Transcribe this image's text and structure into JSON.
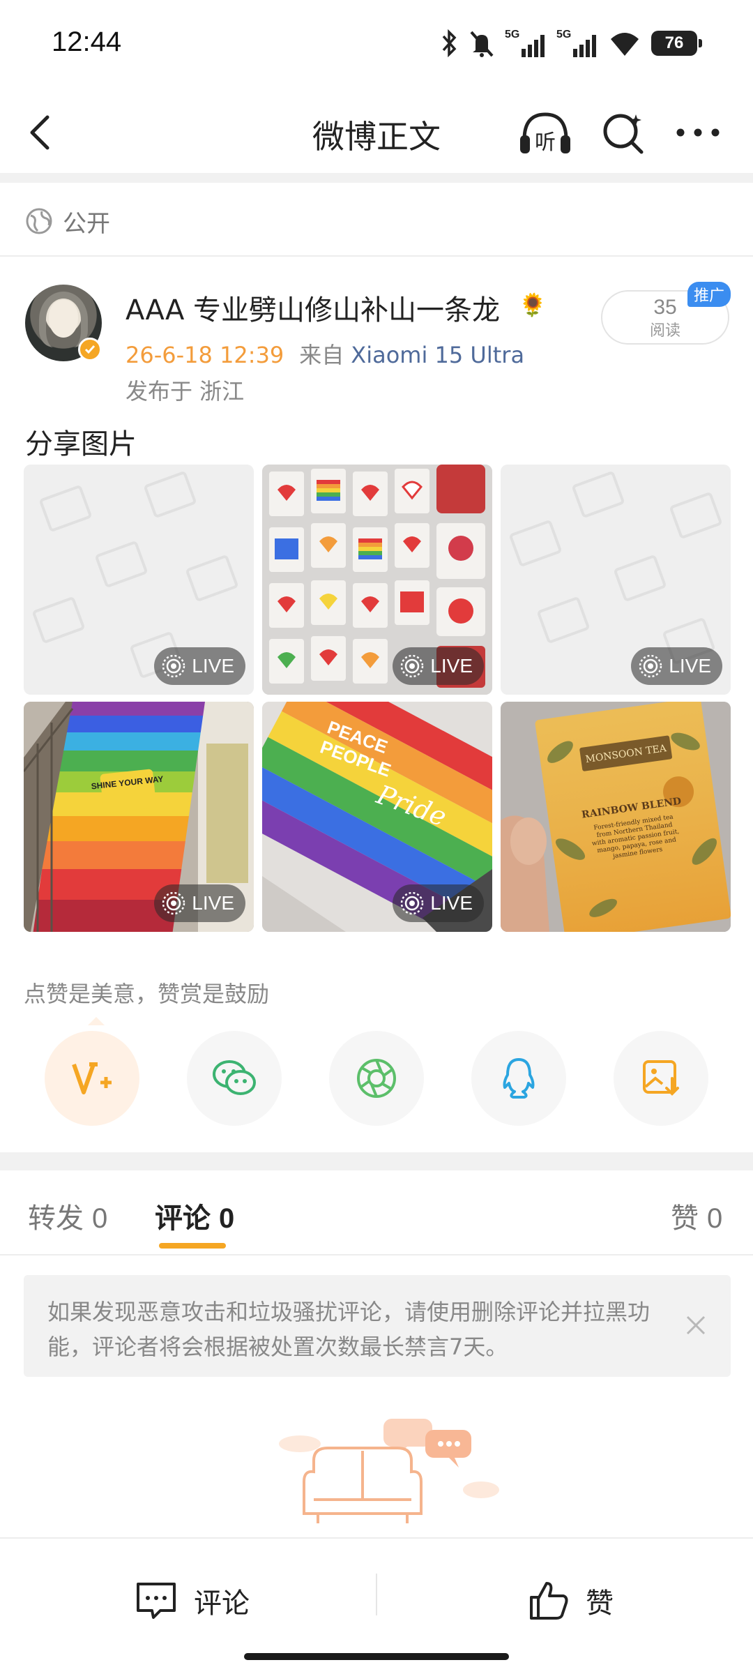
{
  "status_bar": {
    "time": "12:44",
    "network_1": "5G",
    "network_2": "5G",
    "battery": "76"
  },
  "nav": {
    "title": "微博正文",
    "listen_label": "听"
  },
  "visibility": {
    "label": "公开"
  },
  "post": {
    "author": "AAA 专业劈山修山补山一条龙",
    "author_emoji": "🌻",
    "time": "26-6-18 12:39",
    "from_prefix": "来自",
    "device": "Xiaomi 15 Ultra",
    "location": "发布于 浙江",
    "read_count": "35",
    "read_label": "阅读",
    "promo": "推广",
    "text": "分享图片",
    "images": [
      {
        "live": "LIVE"
      },
      {
        "live": "LIVE"
      },
      {
        "live": "LIVE"
      },
      {
        "live": "LIVE",
        "sign_text": "SHINE YOUR WAY"
      },
      {
        "live": "LIVE",
        "floor_text_1": "PEACE",
        "floor_text_2": "PEOPLE",
        "floor_text_3": "Pride"
      },
      {
        "brand": "MONSOON TEA",
        "product": "RAINBOW BLEND",
        "desc": "Forest-friendly mixed tea from Northern Thailand with aromatic passion fruit, mango, papaya, rose and jasmine flowers"
      }
    ]
  },
  "encourage": {
    "text": "点赞是美意，赞赏是鼓励"
  },
  "share": {
    "buttons": [
      "reward-icon",
      "wechat-icon",
      "moments-icon",
      "qq-icon",
      "save-image-icon"
    ],
    "colors": {
      "reward": "#f5a623",
      "wechat": "#3cb371",
      "moments": "#5cbf6a",
      "qq": "#2ba5e0",
      "save": "#f5a623"
    }
  },
  "tabs": {
    "repost": {
      "label": "转发",
      "count": "0"
    },
    "comment": {
      "label": "评论",
      "count": "0"
    },
    "like": {
      "label": "赞",
      "count": "0"
    }
  },
  "notice": {
    "text": "如果发现恶意攻击和垃圾骚扰评论，请使用删除评论并拉黑功能，评论者将会根据被处置次数最长禁言7天。"
  },
  "bottom_bar": {
    "comment": "评论",
    "like": "赞"
  },
  "colors": {
    "accent": "#f5a623",
    "time": "#f39c3b",
    "link": "#4f6a9a",
    "promo": "#3b8df0"
  }
}
